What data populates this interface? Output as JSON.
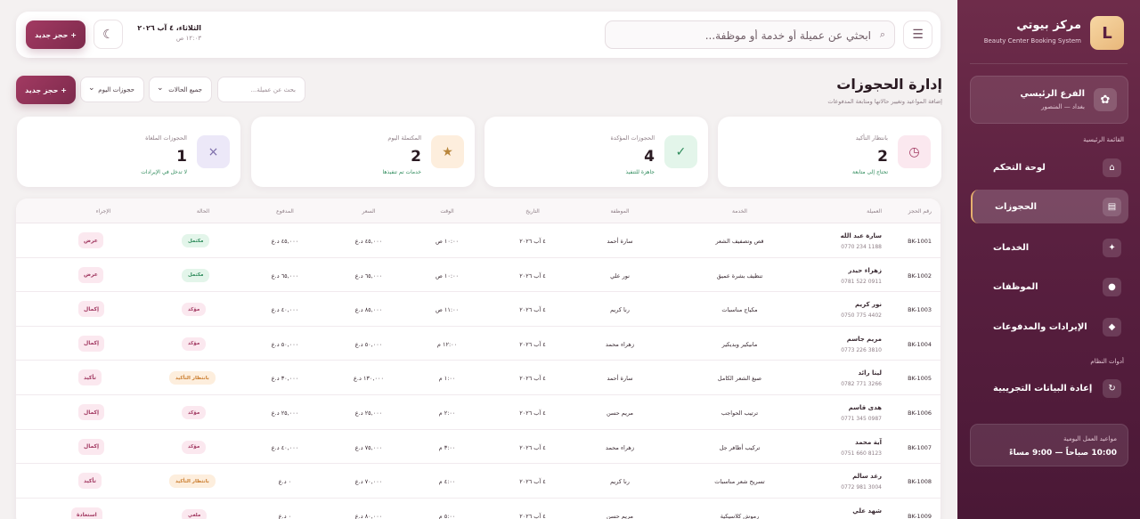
{
  "sidebar": {
    "logo_letter": "L",
    "brand_name": "مركز بيوتي",
    "brand_sub": "Beauty Center Booking System",
    "branch": {
      "icon": "flower-icon",
      "name": "الفرع الرئيسي",
      "location": "بغداد — المنصور"
    },
    "main_menu_title": "القائمة الرئيسية",
    "items": [
      {
        "label": "لوحة التحكم",
        "icon": "home-icon"
      },
      {
        "label": "الحجوزات",
        "icon": "calendar-icon",
        "active": true
      },
      {
        "label": "الخدمات",
        "icon": "sparkle-icon"
      },
      {
        "label": "الموظفات",
        "icon": "person-icon"
      },
      {
        "label": "الإيرادات والمدفوعات",
        "icon": "diamond-icon"
      }
    ],
    "tools_title": "أدوات النظام",
    "tools": [
      {
        "label": "إعادة البيانات التجريبية",
        "icon": "refresh-icon"
      }
    ],
    "hours_label": "مواعيد العمل اليومية",
    "hours_value": "10:00 صباحاً — 9:00 مساءً"
  },
  "topbar": {
    "search_placeholder": "ابحثي عن عميلة أو خدمة أو موظفة...",
    "date": "الثلاثاء، ٤ آب ٢٠٢٦",
    "time": "١٢:٠٣ ص",
    "new_booking": "+ حجز جديد"
  },
  "page": {
    "title": "إدارة الحجوزات",
    "subtitle": "إضافة المواعيد وتغيير حالاتها ومتابعة المدفوعات",
    "filter_search_placeholder": "بحث عن عميلة...",
    "filter_status": "جميع الحالات",
    "filter_period": "حجوزات اليوم",
    "new_booking": "+ حجز جديد"
  },
  "stats": [
    {
      "label": "بانتظار التأكيد",
      "value": "2",
      "hint": "تحتاج إلى متابعة",
      "icon": "clock-icon",
      "bg": "#fbe8ef",
      "fg": "#a23a62"
    },
    {
      "label": "الحجوزات المؤكدة",
      "value": "4",
      "hint": "جاهزة للتنفيذ",
      "icon": "check-icon",
      "bg": "#e3f5ea",
      "fg": "#2d8a5a"
    },
    {
      "label": "المكتملة اليوم",
      "value": "2",
      "hint": "خدمات تم تنفيذها",
      "icon": "star-icon",
      "bg": "#fdeedd",
      "fg": "#b8853a"
    },
    {
      "label": "الحجوزات الملغاة",
      "value": "1",
      "hint": "لا تدخل في الإيرادات",
      "icon": "x-icon",
      "bg": "#ece8f8",
      "fg": "#7a6aa8"
    }
  ],
  "table": {
    "headers": [
      "رقم الحجز",
      "العميلة",
      "الخدمة",
      "الموظفة",
      "التاريخ",
      "الوقت",
      "السعر",
      "المدفوع",
      "الحالة",
      "الإجراء"
    ],
    "rows": [
      {
        "id": "BK-1001",
        "name": "سارة عبد الله",
        "phone": "0770 234 1188",
        "service": "قص وتصفيف الشعر",
        "staff": "سارة أحمد",
        "date": "٤ آب ٢٠٢٦",
        "time": "١٠:٠٠ ص",
        "price": "٤٥,٠٠٠ د.ع",
        "paid": "٤٥,٠٠٠ د.ع",
        "status": "مكتمل",
        "status_type": "done",
        "action": "عرض"
      },
      {
        "id": "BK-1002",
        "name": "زهراء حيدر",
        "phone": "0781 522 0911",
        "service": "تنظيف بشرة عميق",
        "staff": "نور علي",
        "date": "٤ آب ٢٠٢٦",
        "time": "١٠:٠٠ ص",
        "price": "٦٥,٠٠٠ د.ع",
        "paid": "٦٥,٠٠٠ د.ع",
        "status": "مكتمل",
        "status_type": "done",
        "action": "عرض"
      },
      {
        "id": "BK-1003",
        "name": "نور كريم",
        "phone": "0750 775 4402",
        "service": "مكياج مناسبات",
        "staff": "رنا كريم",
        "date": "٤ آب ٢٠٢٦",
        "time": "١١:٠٠ ص",
        "price": "٨٥,٠٠٠ د.ع",
        "paid": "٤٠,٠٠٠ د.ع",
        "status": "مؤكد",
        "status_type": "conf",
        "action": "إكمال"
      },
      {
        "id": "BK-1004",
        "name": "مريم جاسم",
        "phone": "0773 226 3810",
        "service": "مانيكير وبديكير",
        "staff": "زهراء محمد",
        "date": "٤ آب ٢٠٢٦",
        "time": "١٢:٠٠ م",
        "price": "٥٠,٠٠٠ د.ع",
        "paid": "٥٠,٠٠٠ د.ع",
        "status": "مؤكد",
        "status_type": "conf",
        "action": "إكمال"
      },
      {
        "id": "BK-1005",
        "name": "لينا رائد",
        "phone": "0782 771 3266",
        "service": "صبغ الشعر الكامل",
        "staff": "سارة أحمد",
        "date": "٤ آب ٢٠٢٦",
        "time": "١:٠٠ م",
        "price": "١٣٠,٠٠٠ د.ع",
        "paid": "٣٠,٠٠٠ د.ع",
        "status": "بانتظار التأكيد",
        "status_type": "pend",
        "action": "تأكيد"
      },
      {
        "id": "BK-1006",
        "name": "هدى قاسم",
        "phone": "0771 345 0987",
        "service": "ترتيب الحواجب",
        "staff": "مريم حسن",
        "date": "٤ آب ٢٠٢٦",
        "time": "٢:٠٠ م",
        "price": "٢٥,٠٠٠ د.ع",
        "paid": "٢٥,٠٠٠ د.ع",
        "status": "مؤكد",
        "status_type": "conf",
        "action": "إكمال"
      },
      {
        "id": "BK-1007",
        "name": "آية محمد",
        "phone": "0751 660 8123",
        "service": "تركيب أظافر جل",
        "staff": "زهراء محمد",
        "date": "٤ آب ٢٠٢٦",
        "time": "٣:٠٠ م",
        "price": "٧٥,٠٠٠ د.ع",
        "paid": "٤٠,٠٠٠ د.ع",
        "status": "مؤكد",
        "status_type": "conf",
        "action": "إكمال"
      },
      {
        "id": "BK-1008",
        "name": "رغد سالم",
        "phone": "0772 981 3004",
        "service": "تسريح شعر مناسبات",
        "staff": "رنا كريم",
        "date": "٤ آب ٢٠٢٦",
        "time": "٤:٠٠ م",
        "price": "٧٠,٠٠٠ د.ع",
        "paid": "٠ د.ع",
        "status": "بانتظار التأكيد",
        "status_type": "pend",
        "action": "تأكيد"
      },
      {
        "id": "BK-1009",
        "name": "شهد علي",
        "phone": "",
        "service": "رموش كلاسيكية",
        "staff": "مريم حسن",
        "date": "٤ آب ٢٠٢٦",
        "time": "٥:٠٠ م",
        "price": "٨٠,٠٠٠ د.ع",
        "paid": "٠ د.ع",
        "status": "ملغي",
        "status_type": "conf",
        "action": "استعادة"
      }
    ]
  }
}
